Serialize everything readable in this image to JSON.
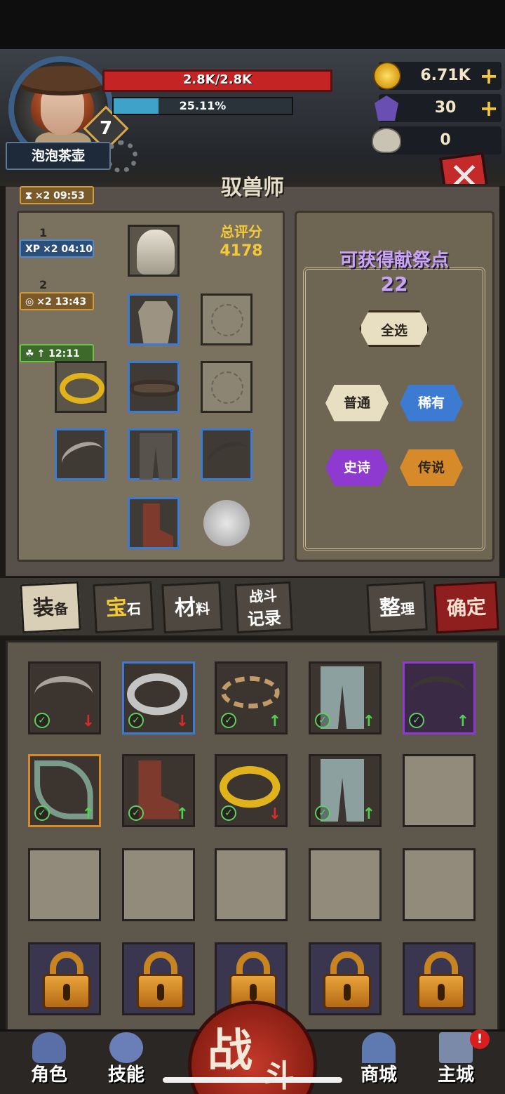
{
  "player": {
    "name": "泡泡茶壶",
    "level": "7",
    "hp_text": "2.8K/2.8K",
    "xp_text": "25.11%",
    "xp_fraction": 0.2511
  },
  "resources": {
    "gold": "6.71K",
    "gems": "30",
    "skulls": "0"
  },
  "buffs": [
    {
      "icon": "hourglass-icon",
      "text": "×2 09:53"
    },
    {
      "icon": "xp-icon",
      "prefix": "XP",
      "text": "×2 04:10"
    },
    {
      "icon": "coin-buff-icon",
      "text": "×2 13:43"
    },
    {
      "icon": "clover-icon",
      "text": "↑ 12:11"
    }
  ],
  "step_labels": [
    "1",
    "2"
  ],
  "panel": {
    "class_title": "驭兽师",
    "score_label": "总评分",
    "score_value": "4178"
  },
  "sacrifice": {
    "title": "可获得献祭点",
    "count": "22",
    "select_all": "全选",
    "filters": {
      "common": "普通",
      "rare": "稀有",
      "epic": "史诗",
      "legendary": "传说"
    }
  },
  "tabs": {
    "equipment": [
      "装",
      "备"
    ],
    "gems": [
      "宝",
      "石"
    ],
    "materials": [
      "材",
      "料"
    ],
    "battle_log": [
      "战斗",
      "记录"
    ],
    "sort": [
      "整",
      "理"
    ],
    "confirm": "确定"
  },
  "nav": {
    "character": "角色",
    "skills": "技能",
    "battle_a": "战",
    "battle_b": "斗",
    "shop": "商城",
    "main_city": "主城",
    "alert": "!"
  },
  "colors": {
    "hp": "#c42424",
    "xp": "#3fa3c9",
    "gold": "#f2c737",
    "sacrifice_text": "#c9a6f2",
    "rarity_common": "#e8dfc2",
    "rarity_rare": "#3d7ad1",
    "rarity_epic": "#8e3ad1",
    "rarity_legendary": "#d78a2a"
  }
}
